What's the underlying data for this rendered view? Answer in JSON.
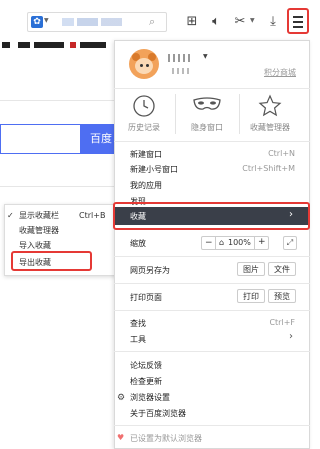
{
  "toolbar": {
    "search_glyph": "⌕",
    "icons": [
      "toolbox-icon",
      "speaker-icon",
      "scissors-icon",
      "download-icon",
      "menu-icon"
    ]
  },
  "page": {
    "search_button": "百度"
  },
  "submenu": {
    "items": [
      {
        "label": "显示收藏栏",
        "shortcut": "Ctrl+B",
        "checked": true
      },
      {
        "label": "收藏管理器",
        "shortcut": "",
        "checked": false
      },
      {
        "label": "导入收藏",
        "shortcut": "",
        "checked": false
      },
      {
        "label": "导出收藏",
        "shortcut": "",
        "checked": false
      }
    ],
    "check_mark": "✓"
  },
  "menu": {
    "mall_link": "积分商城",
    "quick_actions": [
      {
        "label": "历史记录",
        "icon": "clock-icon"
      },
      {
        "label": "隐身窗口",
        "icon": "mask-icon"
      },
      {
        "label": "收藏管理器",
        "icon": "star-icon"
      }
    ],
    "new_window": {
      "label": "新建窗口",
      "shortcut": "Ctrl+N"
    },
    "new_small_window": {
      "label": "新建小号窗口",
      "shortcut": "Ctrl+Shift+M"
    },
    "my_apps": "我的应用",
    "discover": "发现",
    "favorites": "收藏",
    "zoom": {
      "label": "缩放",
      "minus": "−",
      "value": "100%",
      "plus": "+"
    },
    "save_as": {
      "label": "网页另存为",
      "image_btn": "图片",
      "file_btn": "文件"
    },
    "print": {
      "label": "打印页面",
      "print_btn": "打印",
      "preview_btn": "预览"
    },
    "find": {
      "label": "查找",
      "shortcut": "Ctrl+F"
    },
    "tools": "工具",
    "feedback": "论坛反馈",
    "check_update": "检查更新",
    "browser_settings": "浏览器设置",
    "about": "关于百度浏览器",
    "default_browser": "已设置为默认浏览器"
  },
  "colors": {
    "highlight": "#e53935",
    "hover": "#3a3f49",
    "accent": "#4e6ef2"
  }
}
